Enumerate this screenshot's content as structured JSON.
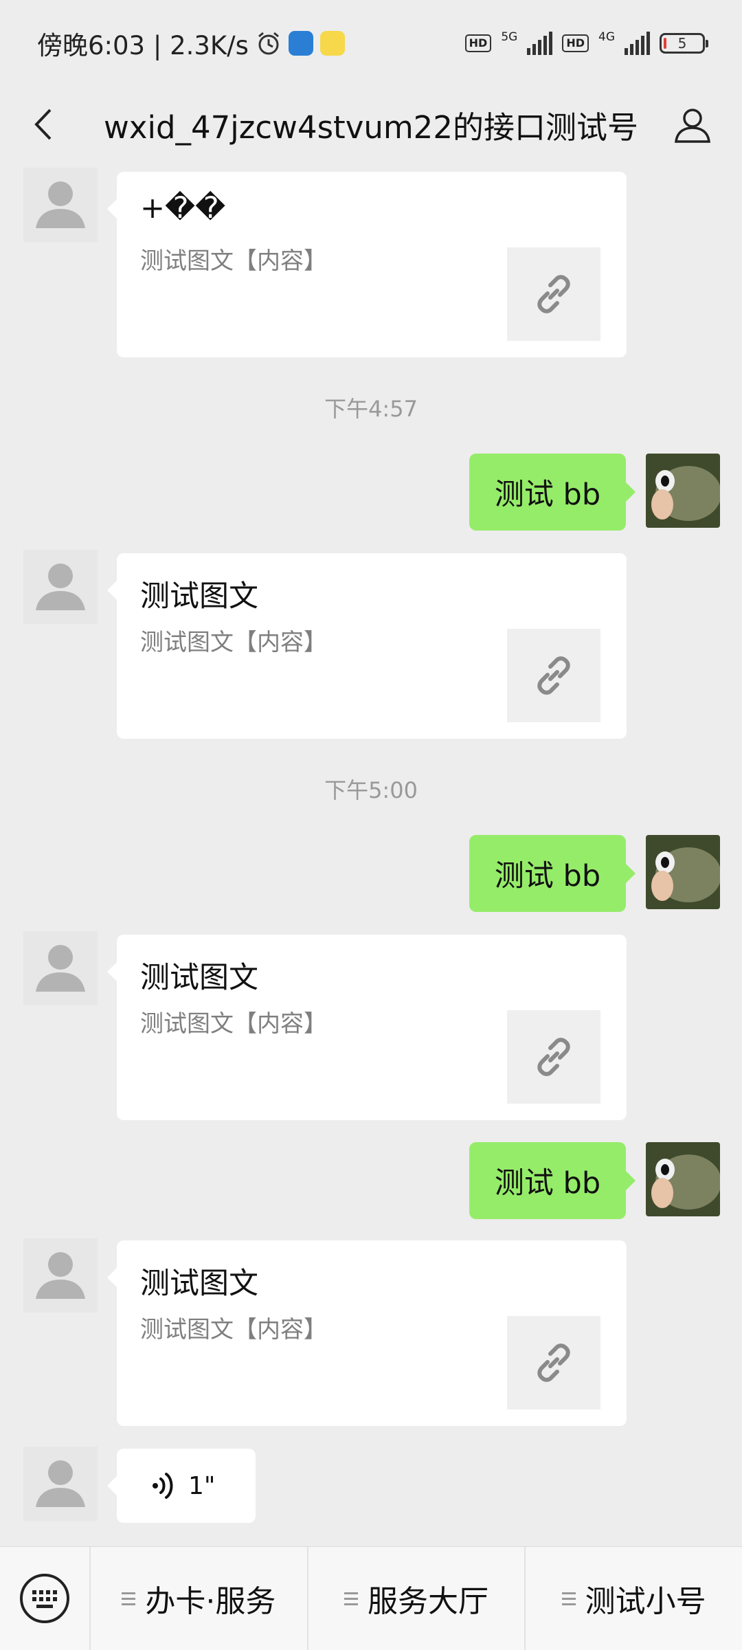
{
  "status_bar": {
    "time_speed": "傍晚6:03 | 2.3K/s",
    "hd1": "HD",
    "net1": "5G",
    "hd2": "HD",
    "net2": "4G",
    "battery": "5"
  },
  "nav": {
    "title": "wxid_47jzcw4stvum22的接口测试号"
  },
  "messages": {
    "card1": {
      "title": "+��",
      "desc": "测试图文【内容】"
    },
    "time1": "下午4:57",
    "sent1": "测试 bb",
    "card2": {
      "title": "测试图文",
      "desc": "测试图文【内容】"
    },
    "time2": "下午5:00",
    "sent2": "测试 bb",
    "card3": {
      "title": "测试图文",
      "desc": "测试图文【内容】"
    },
    "sent3": "测试 bb",
    "card4": {
      "title": "测试图文",
      "desc": "测试图文【内容】"
    },
    "voice_duration": "1\""
  },
  "bottom_menu": {
    "item1": "办卡·服务",
    "item2": "服务大厅",
    "item3": "测试小号"
  },
  "colors": {
    "chat_bg": "#ededed",
    "sent_bubble": "#95ec69",
    "received_bubble": "#ffffff"
  }
}
